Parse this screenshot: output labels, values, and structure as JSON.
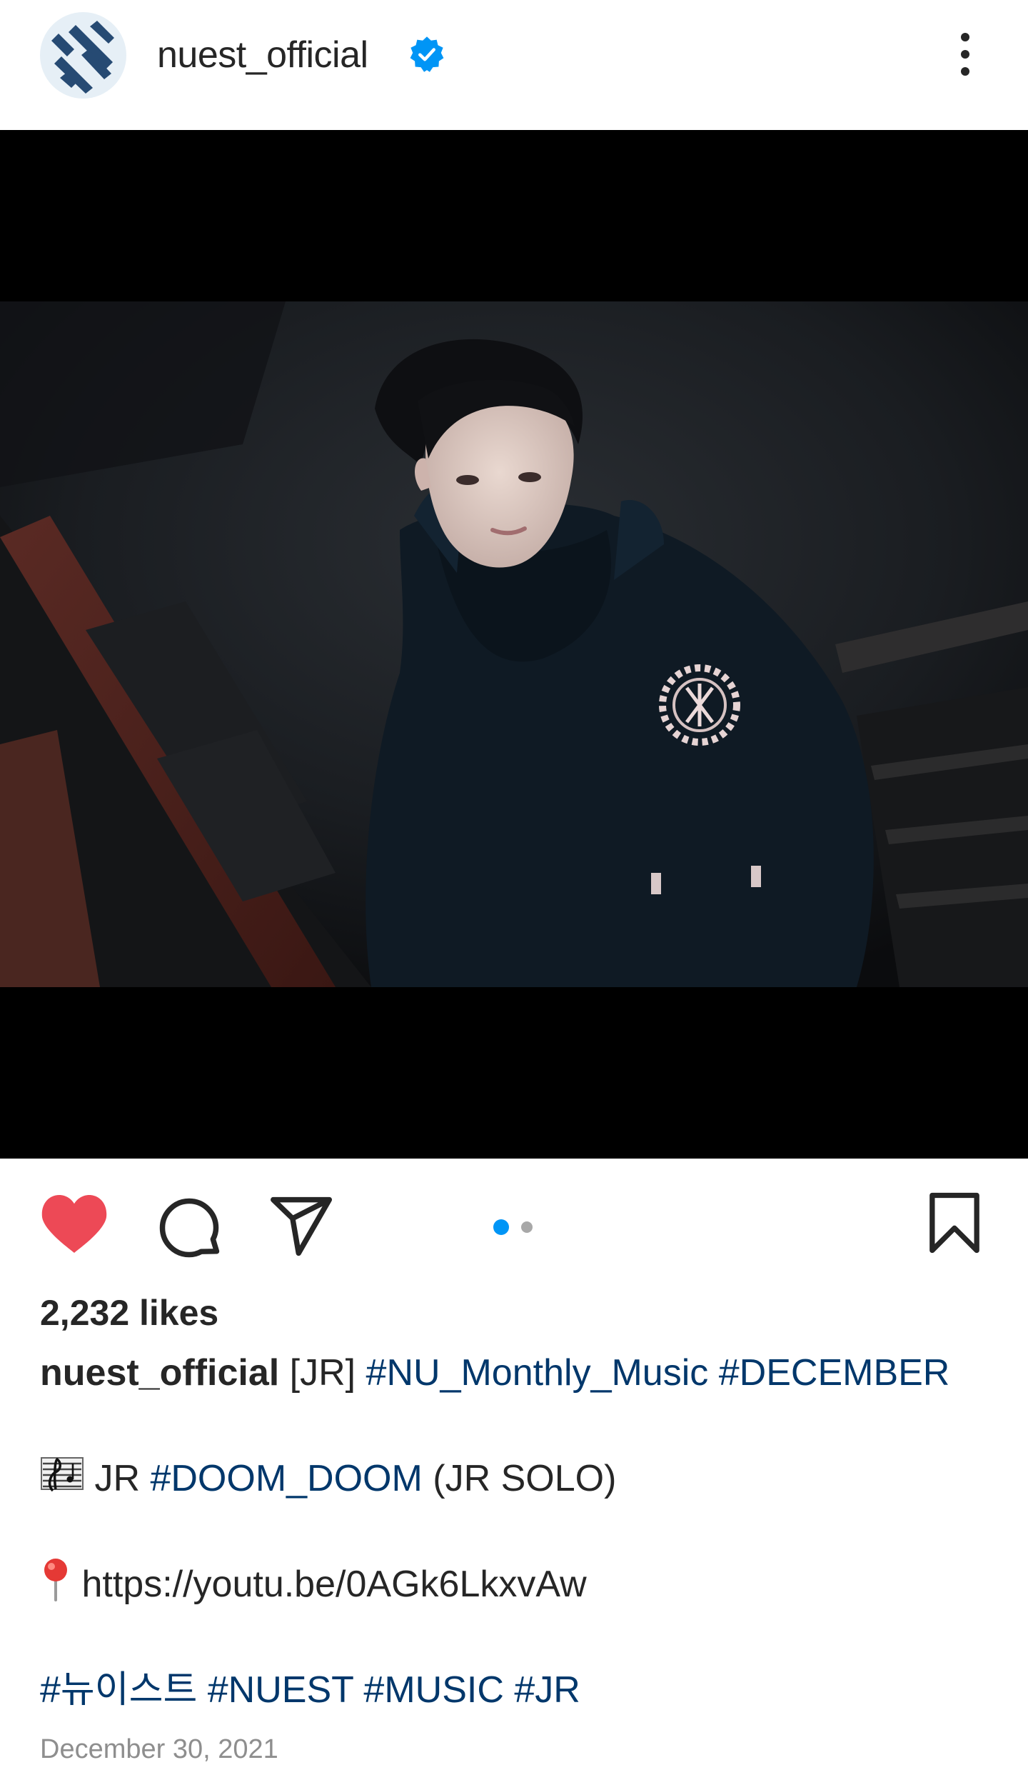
{
  "post": {
    "username": "nuest_official",
    "verified": true,
    "likes": "2,232 likes",
    "date": "December 30, 2021",
    "carousel": {
      "count": 2,
      "active": 0,
      "active_color": "#0095f6",
      "inactive_color": "#a8a8a8"
    },
    "caption": {
      "author": "nuest_official",
      "line1": [
        {
          "text": "[JR] ",
          "tag": false
        },
        {
          "text": "#NU_Monthly_Music",
          "tag": true
        },
        {
          "text": " ",
          "tag": false
        },
        {
          "text": "#DECEMBER",
          "tag": true
        }
      ],
      "line2": [
        {
          "text": " JR ",
          "tag": false
        },
        {
          "text": "#DOOM_DOOM",
          "tag": true
        },
        {
          "text": " (JR SOLO)",
          "tag": false
        }
      ],
      "line3": {
        "text": " https://youtu.be/0AGk6LkxvAw"
      },
      "line4": [
        {
          "text": "#뉴이스트",
          "tag": true
        },
        {
          "text": " ",
          "tag": false
        },
        {
          "text": "#NUEST",
          "tag": true
        },
        {
          "text": " ",
          "tag": false
        },
        {
          "text": "#MUSIC",
          "tag": true
        },
        {
          "text": " ",
          "tag": false
        },
        {
          "text": "#JR",
          "tag": true
        }
      ]
    }
  },
  "icons": {
    "like": "heart-filled-icon",
    "comment": "comment-icon",
    "share": "paper-plane-icon",
    "save": "bookmark-icon",
    "more": "more-vertical-icon",
    "verified": "verified-badge-icon",
    "music": "musical-score-emoji",
    "pin": "round-pushpin-emoji"
  },
  "colors": {
    "heart": "#ed4956",
    "hashtag": "#00376b",
    "verified": "#0095f6",
    "text": "#262626",
    "muted": "#8e8e8e"
  }
}
